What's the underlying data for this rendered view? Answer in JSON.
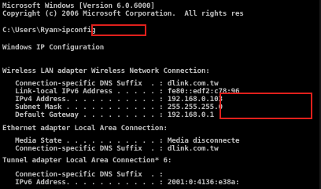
{
  "console": {
    "lines": [
      "Microsoft Windows [Version 6.0.6000]",
      "Copyright (c) 2006 Microsoft Corporation.  All rights res",
      "",
      "C:\\Users\\Ryan>ipconfig",
      "",
      "Windows IP Configuration",
      "",
      "",
      "Wireless LAN adapter Wireless Network Connection:",
      "",
      "   Connection-specific DNS Suffix  . : dlink.com.tw",
      "   Link-local IPv6 Address . . . . . : fe80::edf2:c78:96",
      "   IPv4 Address. . . . . . . . . . . : 192.168.0.103",
      "   Subnet Mask . . . . . . . . . . . : 255.255.255.0",
      "   Default Gateway . . . . . . . . . : 192.168.0.1",
      "",
      "Ethernet adapter Local Area Connection:",
      "",
      "   Media State . . . . . . . . . . . : Media disconnecte",
      "   Connection-specific DNS Suffix  . : dlink.com.tw",
      "",
      "Tunnel adapter Local Area Connection* 6:",
      "",
      "   Connection-specific DNS Suffix  . :",
      "   IPv6 Address. . . . . . . . . . . : 2001:0:4136:e38a:"
    ]
  }
}
